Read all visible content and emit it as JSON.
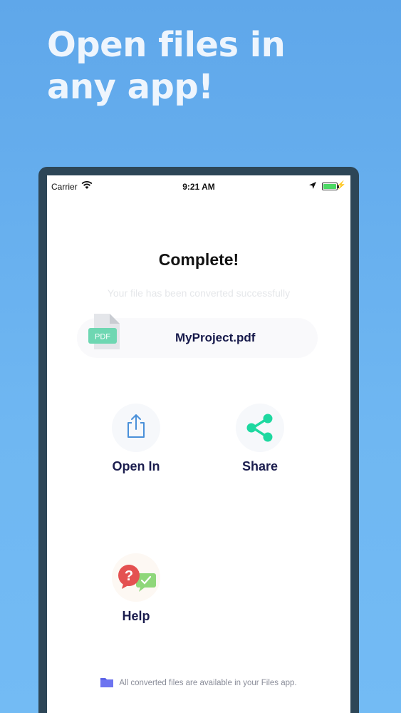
{
  "promo": {
    "headline": "Open files in any app!"
  },
  "status_bar": {
    "carrier": "Carrier",
    "time": "9:21 AM",
    "icons": [
      "wifi-icon",
      "location-arrow-icon",
      "battery-icon",
      "charging-bolt-icon"
    ]
  },
  "result": {
    "title": "Complete!",
    "subtitle": "Your file has been converted successfully",
    "file": {
      "badge": "PDF",
      "name": "MyProject.pdf"
    }
  },
  "actions": {
    "open_in": {
      "label": "Open In",
      "icon": "share-upload-icon"
    },
    "share": {
      "label": "Share",
      "icon": "share-nodes-icon"
    },
    "help": {
      "label": "Help",
      "icon": "help-chat-bubbles-icon"
    }
  },
  "footer": {
    "note": "All converted files are available in your Files app.",
    "icon": "folder-icon"
  },
  "colors": {
    "background": "#6fb7f2",
    "device_frame": "#2d4657",
    "pdf_badge": "#6ed7b2",
    "share_icon": "#1ed8a0",
    "open_in_icon": "#4a90d9",
    "help_red": "#e45151",
    "help_green": "#8fd77a",
    "folder": "#5b62e8",
    "title_text": "#16194a"
  }
}
